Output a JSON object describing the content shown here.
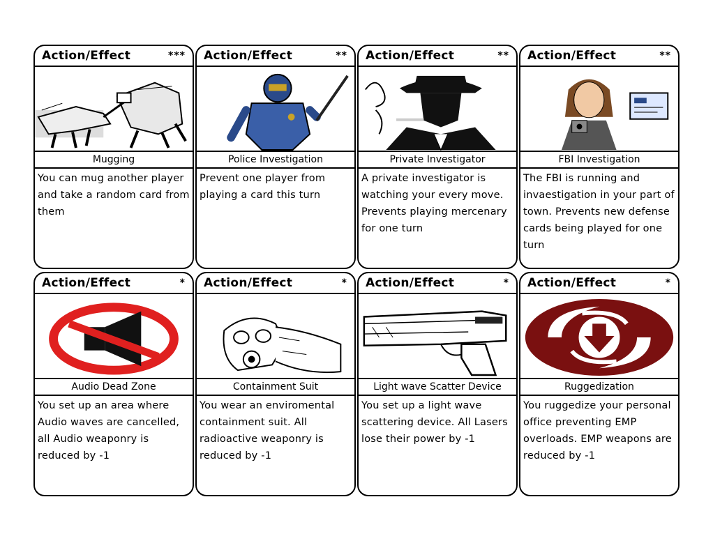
{
  "cards": [
    {
      "header": "Action/Effect",
      "rank": "***",
      "name": "Mugging",
      "description": "You can mug another player and take a random card from them",
      "art_icon": "mugging-illustration"
    },
    {
      "header": "Action/Effect",
      "rank": "**",
      "name": "Police Investigation",
      "description": "Prevent one player from playing a card this turn",
      "art_icon": "armored-police-illustration"
    },
    {
      "header": "Action/Effect",
      "rank": "**",
      "name": "Private Investigator",
      "description": "A private investigator is watching your every move. Prevents playing mercenary for one turn",
      "art_icon": "detective-illustration"
    },
    {
      "header": "Action/Effect",
      "rank": "**",
      "name": "FBI Investigation",
      "description": "The FBI is running and invaestigation in your part of town.  Prevents new defense cards being played for one turn",
      "art_icon": "fbi-agent-illustration"
    },
    {
      "header": "Action/Effect",
      "rank": "*",
      "name": "Audio Dead Zone",
      "description": "You set up an area where Audio waves are cancelled, all Audio weaponry is reduced by -1",
      "art_icon": "no-audio-icon"
    },
    {
      "header": "Action/Effect",
      "rank": "*",
      "name": "Containment Suit",
      "description": "You wear an enviromental containment suit.  All radioactive weaponry is reduced by -1",
      "art_icon": "gas-mask-illustration"
    },
    {
      "header": "Action/Effect",
      "rank": "*",
      "name": "Light wave Scatter Device",
      "description": "You set up a light wave scattering device.  All Lasers lose their power by -1",
      "art_icon": "laser-gun-illustration"
    },
    {
      "header": "Action/Effect",
      "rank": "*",
      "name": "Ruggedization",
      "description": "You ruggedize your personal office preventing EMP overloads.  EMP weapons are reduced by -1",
      "art_icon": "emp-shield-icon"
    }
  ],
  "colors": {
    "no_audio_red": "#e0201f",
    "emp_red": "#7a1010"
  }
}
